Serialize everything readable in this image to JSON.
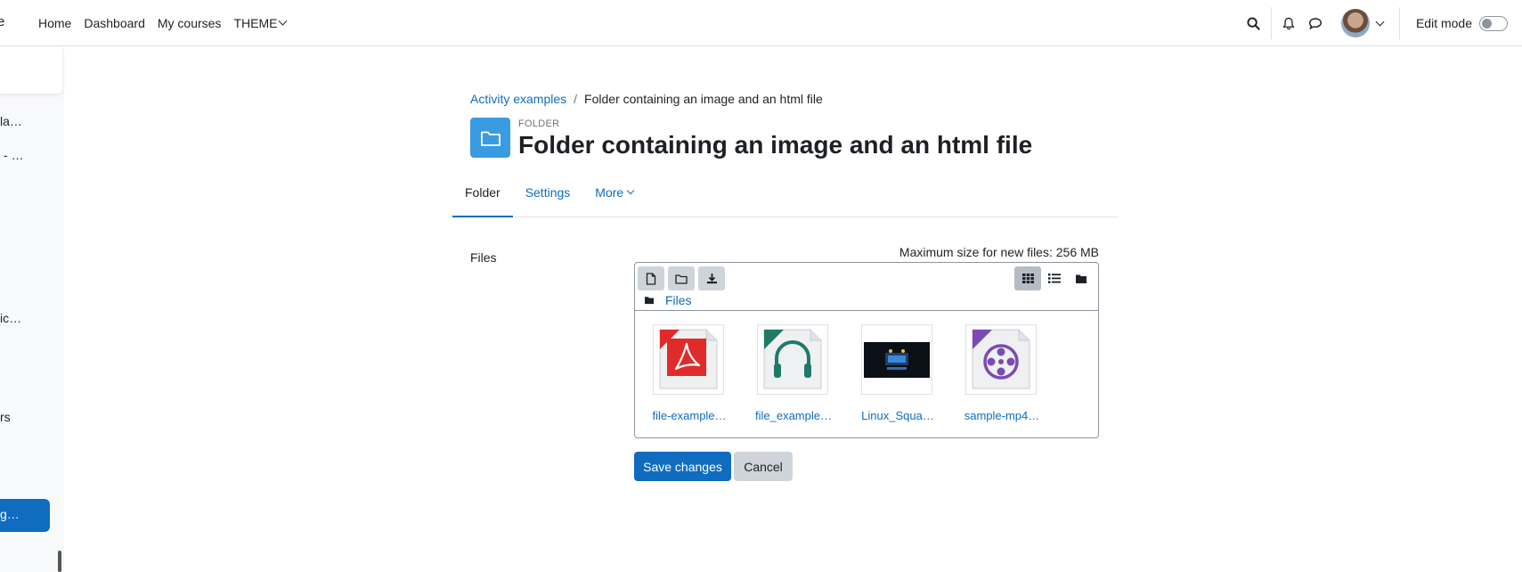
{
  "navbar": {
    "brand_fragment": "e",
    "links": [
      {
        "label": "Home"
      },
      {
        "label": "Dashboard"
      },
      {
        "label": "My courses"
      },
      {
        "label": "THEME"
      }
    ],
    "edit_mode_label": "Edit mode",
    "edit_mode_on": false
  },
  "drawer": {
    "items": [
      "la…",
      "- …",
      "ic…",
      "rs"
    ],
    "active_item": "g…"
  },
  "breadcrumb": {
    "parent": "Activity examples",
    "separator": "/",
    "current": "Folder containing an image and an html file"
  },
  "header": {
    "kicker": "FOLDER",
    "title": "Folder containing an image and an html file"
  },
  "tabs": [
    {
      "label": "Folder",
      "active": true
    },
    {
      "label": "Settings",
      "active": false
    },
    {
      "label": "More",
      "active": false
    }
  ],
  "form": {
    "files_label": "Files",
    "max_size": "Maximum size for new files: 256 MB",
    "path_label": "Files",
    "files": [
      {
        "name": "file-example…",
        "icon": "pdf-icon"
      },
      {
        "name": "file_example…",
        "icon": "audio-icon"
      },
      {
        "name": "Linux_Squa…",
        "icon": "image-thumbnail"
      },
      {
        "name": "sample-mp4…",
        "icon": "video-icon"
      }
    ],
    "save_label": "Save changes",
    "cancel_label": "Cancel"
  },
  "colors": {
    "primary": "#0f6cbf",
    "folder_badge": "#399be2",
    "pdf": "#e02b2b",
    "audio": "#1e7a67",
    "video": "#7a4bb3"
  }
}
